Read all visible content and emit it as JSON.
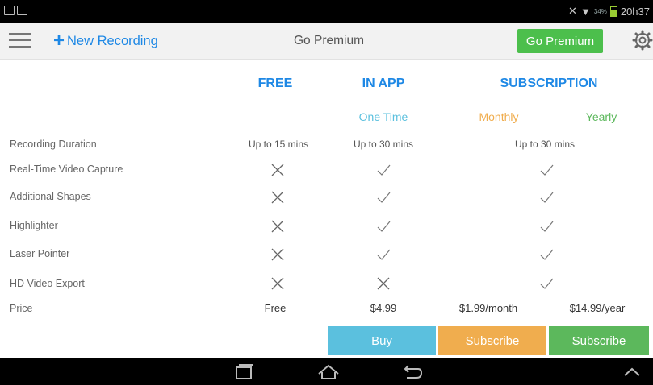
{
  "status_bar": {
    "time": "20h37",
    "battery": "34%",
    "icons": [
      "screenshot-icon",
      "gallery-icon",
      "mute-icon",
      "wifi-icon",
      "battery-icon"
    ]
  },
  "app_bar": {
    "menu_icon": "hamburger-icon",
    "new_recording": "New Recording",
    "title": "Go Premium",
    "premium_button": "Go Premium",
    "settings_icon": "gear-icon"
  },
  "plans": {
    "free": "FREE",
    "in_app": "IN APP",
    "subscription": "SUBSCRIPTION",
    "one_time": "One Time",
    "monthly": "Monthly",
    "yearly": "Yearly"
  },
  "rows": {
    "recording_duration": {
      "label": "Recording Duration",
      "free": "Up to 15 mins",
      "in_app": "Up to 30 mins",
      "subscription": "Up to 30 mins"
    },
    "realtime_capture": {
      "label": "Real-Time Video Capture",
      "free": false,
      "in_app": true,
      "subscription": true
    },
    "additional_shapes": {
      "label": "Additional Shapes",
      "free": false,
      "in_app": true,
      "subscription": true
    },
    "highlighter": {
      "label": "Highlighter",
      "free": false,
      "in_app": true,
      "subscription": true
    },
    "laser_pointer": {
      "label": "Laser Pointer",
      "free": false,
      "in_app": true,
      "subscription": true
    },
    "hd_export": {
      "label": "HD Video Export",
      "free": false,
      "in_app": false,
      "subscription": true
    },
    "price": {
      "label": "Price",
      "free": "Free",
      "in_app": "$4.99",
      "monthly": "$1.99/month",
      "yearly": "$14.99/year"
    }
  },
  "buttons": {
    "buy": "Buy",
    "subscribe_monthly": "Subscribe",
    "subscribe_yearly": "Subscribe"
  },
  "colors": {
    "blue": "#1e88e5",
    "one_time": "#5bc0de",
    "monthly": "#f0ad4e",
    "yearly": "#5cb85c",
    "buy": "#5bc0de",
    "subscribe_monthly": "#f0ad4e",
    "subscribe_yearly": "#5cb85c"
  },
  "nav_bar": {
    "icons": [
      "recent-apps-icon",
      "home-icon",
      "back-icon",
      "chevron-up-icon"
    ]
  }
}
